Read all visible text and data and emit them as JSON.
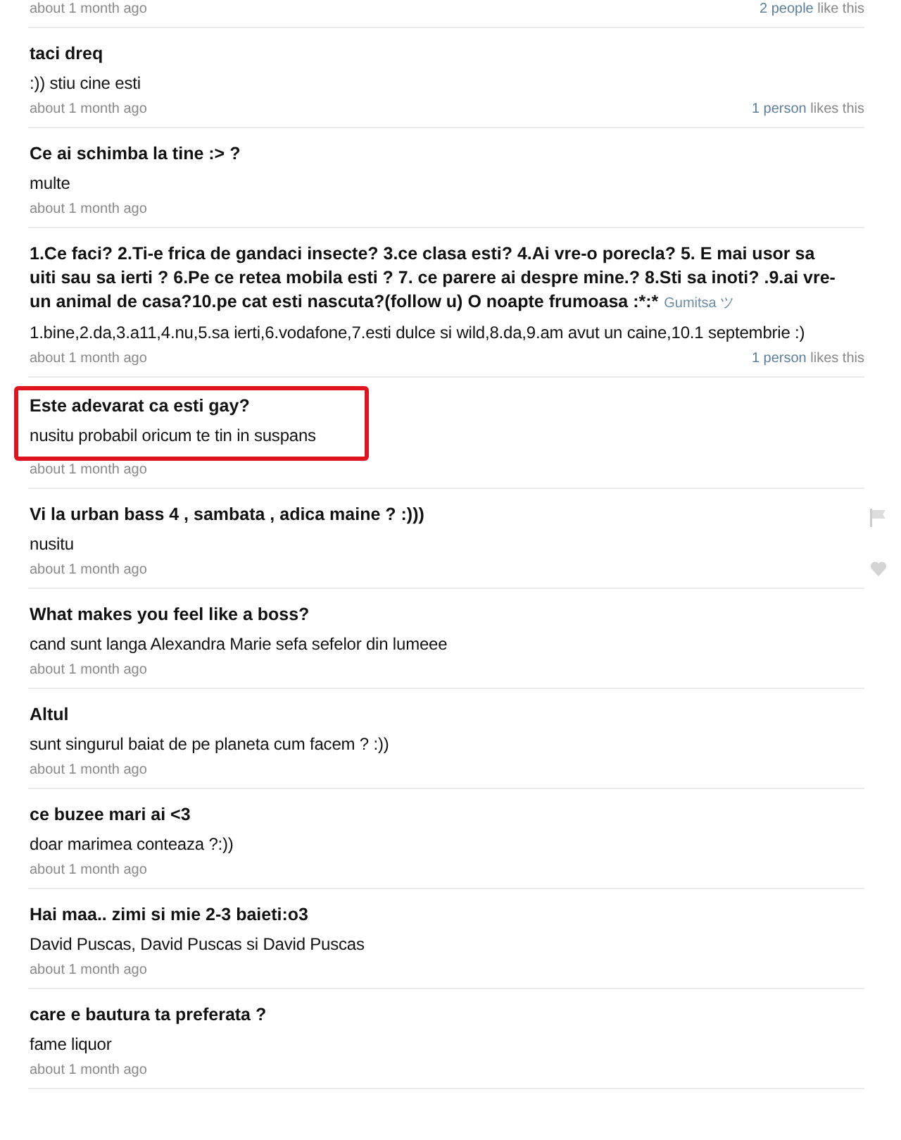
{
  "answers": [
    {
      "time": "about 1 month ago",
      "likes": {
        "who": "2 people",
        "rest": "like this"
      }
    },
    {
      "question": "taci dreq",
      "answer": ":)) stiu cine esti",
      "time": "about 1 month ago",
      "likes": {
        "who": "1 person",
        "rest": "likes this"
      }
    },
    {
      "question": "Ce ai schimba la tine :> ?",
      "answer": "multe",
      "time": "about 1 month ago"
    },
    {
      "question": "1.Ce faci? 2.Ti-e frica de gandaci insecte? 3.ce clasa esti? 4.Ai vre-o porecla? 5. E mai usor sa uiti sau sa ierti ? 6.Pe ce retea mobila esti ? 7. ce parere ai despre mine.? 8.Sti sa inoti? .9.ai vre-un animal de casa?10.pe cat esti nascuta?(follow u) O noapte frumoasa :*:*",
      "asker": "Gumitsa ツ",
      "answer": "1.bine,2.da,3.a11,4.nu,5.sa ierti,6.vodafone,7.esti dulce si wild,8.da,9.am avut un caine,10.1 septembrie :)",
      "time": "about 1 month ago",
      "likes": {
        "who": "1 person",
        "rest": "likes this"
      }
    },
    {
      "question": "Este adevarat ca esti gay?",
      "answer": "nusitu probabil oricum te tin in suspans",
      "time": "about 1 month ago",
      "highlighted": true
    },
    {
      "question": "Vi la urban bass 4 , sambata , adica maine ? :)))",
      "answer": "nusitu",
      "time": "about 1 month ago",
      "hovered": true
    },
    {
      "question": "What makes you feel like a boss?",
      "answer": "cand sunt langa Alexandra Marie sefa sefelor din lumeee",
      "time": "about 1 month ago"
    },
    {
      "question": "Altul",
      "answer": "sunt singurul baiat de pe planeta cum facem ? :))",
      "time": "about 1 month ago"
    },
    {
      "question": "ce buzee mari ai <3",
      "answer": "doar marimea conteaza ?:))",
      "time": "about 1 month ago"
    },
    {
      "question": "Hai maa.. zimi si mie 2-3 baieti:o3",
      "answer": "David Puscas, David Puscas si David Puscas",
      "time": "about 1 month ago"
    },
    {
      "question": "care e bautura ta preferata ?",
      "answer": "fame liquor",
      "time": "about 1 month ago"
    }
  ]
}
